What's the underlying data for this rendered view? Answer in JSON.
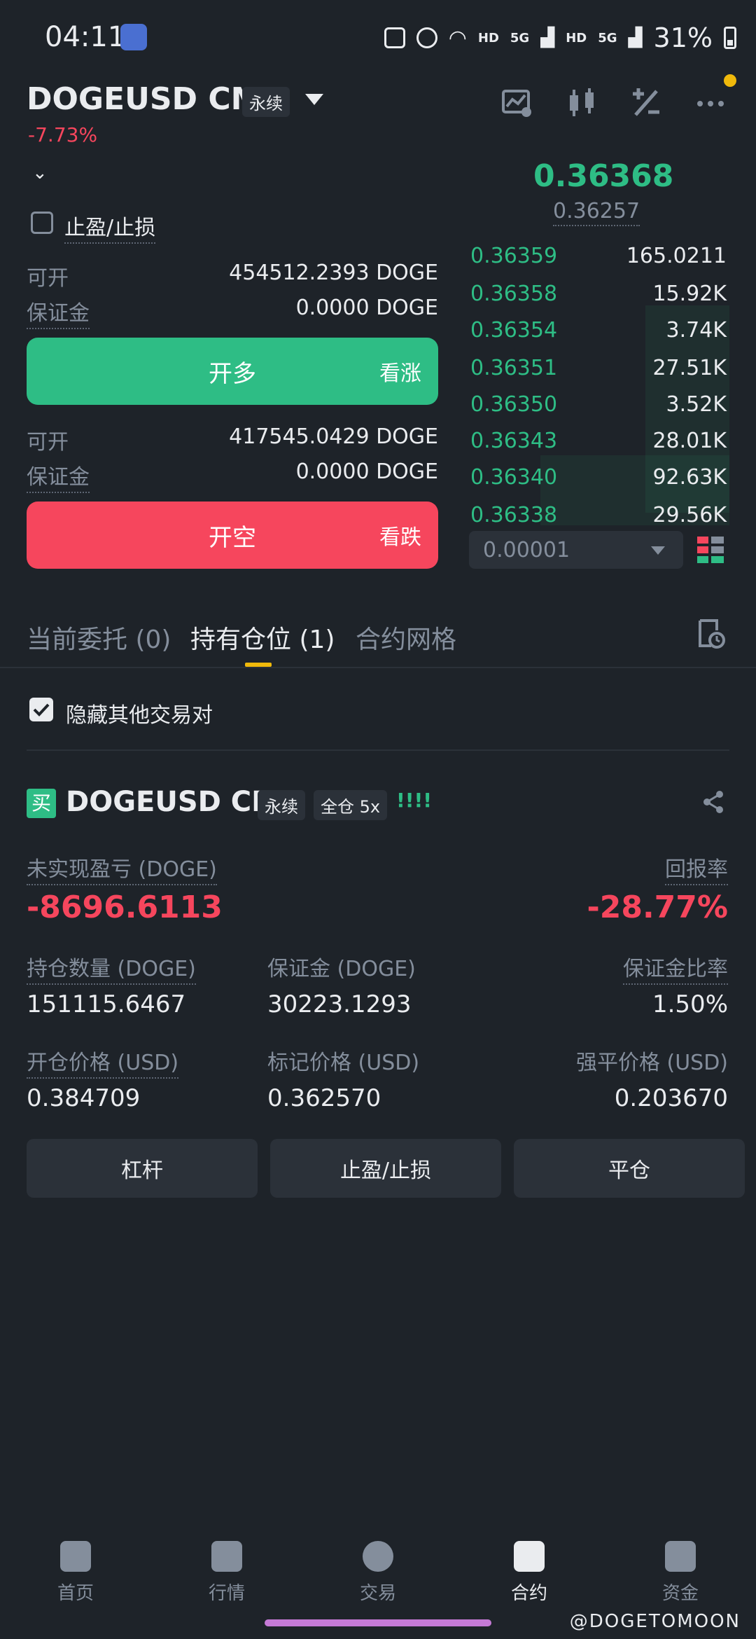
{
  "status_bar": {
    "time": "04:11",
    "hd1": "HD",
    "hd2": "HD",
    "net1": "5G",
    "net2": "5G",
    "battery": "31%"
  },
  "header": {
    "symbol": "DOGEUSD CM",
    "tag": "永续",
    "change": "-7.73%",
    "icons": [
      "chart-icon",
      "candlestick-icon",
      "percent-icon",
      "more-icon"
    ]
  },
  "trade_panel": {
    "tpsl_label": "止盈/止损",
    "long": {
      "available_label": "可开",
      "available_value": "454512.2393 DOGE",
      "margin_label": "保证金",
      "margin_value": "0.0000 DOGE",
      "button_label": "开多",
      "button_side": "看涨"
    },
    "short": {
      "available_label": "可开",
      "available_value": "417545.0429 DOGE",
      "margin_label": "保证金",
      "margin_value": "0.0000 DOGE",
      "button_label": "开空",
      "button_side": "看跌"
    }
  },
  "order_book": {
    "last_price": "0.36368",
    "mark_price": "0.36257",
    "bids": [
      {
        "price": "0.36359",
        "qty": "165.0211"
      },
      {
        "price": "0.36358",
        "qty": "15.92K"
      },
      {
        "price": "0.36354",
        "qty": "3.74K"
      },
      {
        "price": "0.36351",
        "qty": "27.51K"
      },
      {
        "price": "0.36350",
        "qty": "3.52K"
      },
      {
        "price": "0.36343",
        "qty": "28.01K"
      },
      {
        "price": "0.36340",
        "qty": "92.63K"
      },
      {
        "price": "0.36338",
        "qty": "29.56K"
      }
    ],
    "tick_size": "0.00001"
  },
  "tabs": [
    {
      "label": "当前委托 (0)",
      "active": false
    },
    {
      "label": "持有仓位 (1)",
      "active": true
    },
    {
      "label": "合约网格",
      "active": false
    }
  ],
  "hide_pairs_label": "隐藏其他交易对",
  "position": {
    "side_badge": "买",
    "symbol": "DOGEUSD CM",
    "tag_perp": "永续",
    "tag_mode": "全仓 5x",
    "risk": "!!!!",
    "unrealized_label": "未实现盈亏 (DOGE)",
    "unrealized_value": "-8696.6113",
    "roe_label": "回报率",
    "roe_value": "-28.77%",
    "size_label": "持仓数量 (DOGE)",
    "size_value": "151115.6467",
    "margin_label": "保证金 (DOGE)",
    "margin_value": "30223.1293",
    "margin_ratio_label": "保证金比率",
    "margin_ratio_value": "1.50%",
    "entry_label": "开仓价格 (USD)",
    "entry_value": "0.384709",
    "mark_label": "标记价格 (USD)",
    "mark_value": "0.362570",
    "liq_label": "强平价格 (USD)",
    "liq_value": "0.203670",
    "buttons": [
      "杠杆",
      "止盈/止损",
      "平仓"
    ]
  },
  "bottom_nav": [
    {
      "label": "首页",
      "icon": "home-icon",
      "active": false
    },
    {
      "label": "行情",
      "icon": "markets-icon",
      "active": false
    },
    {
      "label": "交易",
      "icon": "trade-icon",
      "active": false
    },
    {
      "label": "合约",
      "icon": "futures-icon",
      "active": true
    },
    {
      "label": "资金",
      "icon": "wallet-icon",
      "active": false
    }
  ],
  "watermark": "@DOGETOMOON",
  "colors": {
    "background": "#1e2329",
    "green": "#2ebd85",
    "red": "#f6465d",
    "accent": "#f0b90b"
  }
}
